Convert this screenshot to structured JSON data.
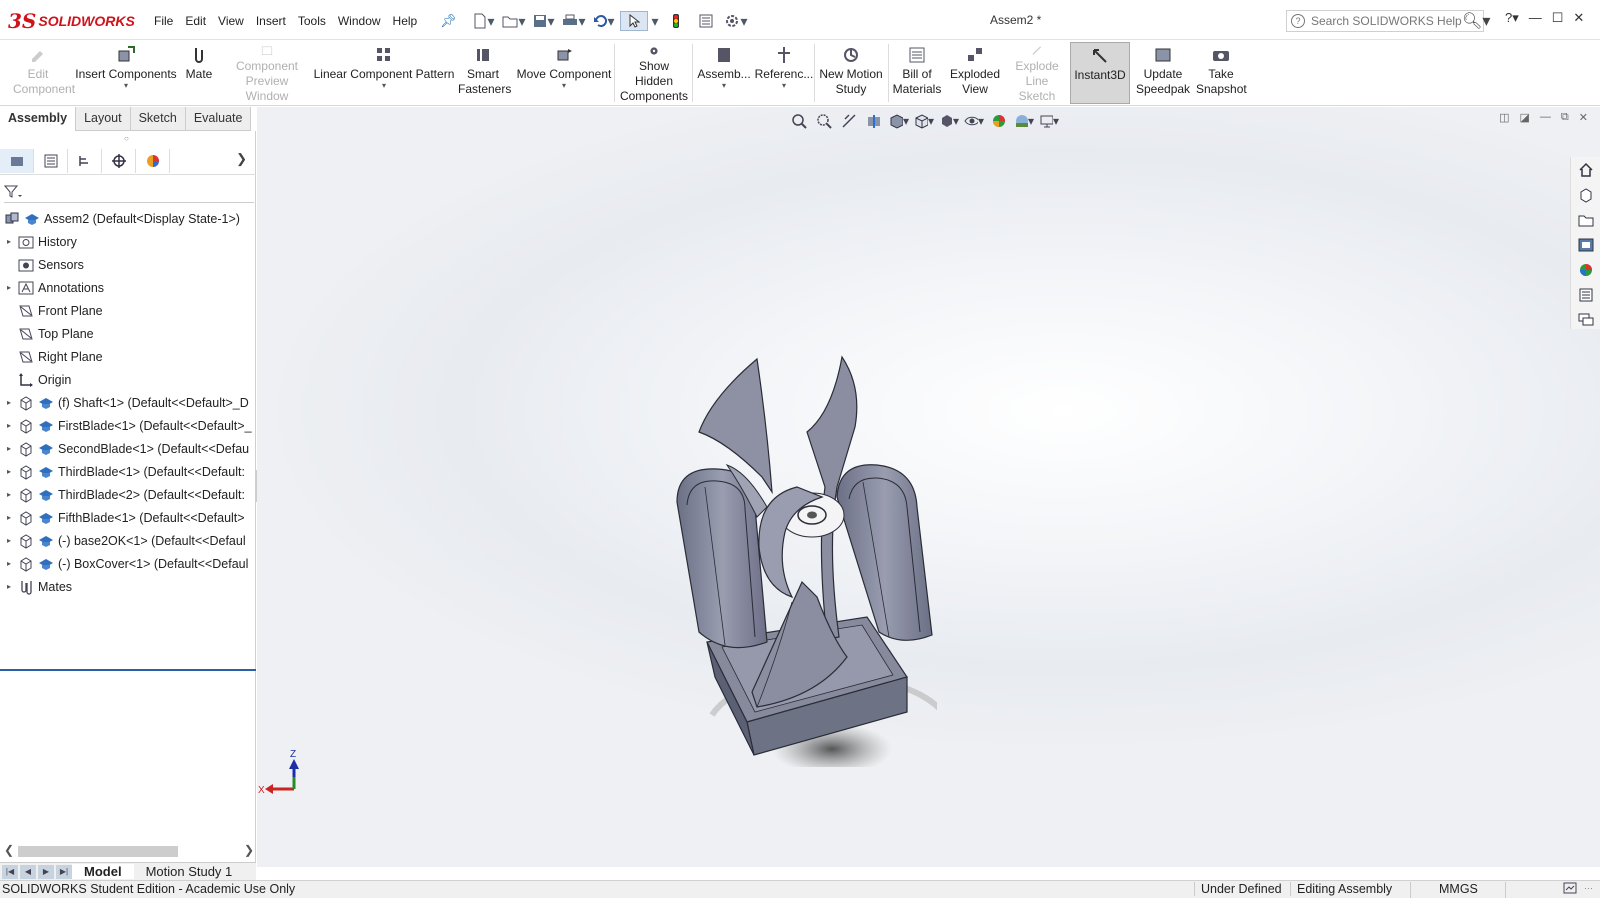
{
  "app": {
    "brand_prefix": "3S",
    "brand": "SOLIDWORKS",
    "document_title": "Assem2 *"
  },
  "menus": [
    "File",
    "Edit",
    "View",
    "Insert",
    "Tools",
    "Window",
    "Help"
  ],
  "search": {
    "placeholder": "Search SOLIDWORKS Help"
  },
  "commands": {
    "edit_component": "Edit Component",
    "insert_components": "Insert Components",
    "mate": "Mate",
    "component_preview_window": "Component Preview Window",
    "linear_component_pattern": "Linear Component Pattern",
    "smart_fasteners": "Smart Fasteners",
    "move_component": "Move Component",
    "show_hidden_components": "Show Hidden Components",
    "assembly": "Assemb...",
    "reference": "Referenc...",
    "new_motion_study": "New Motion Study",
    "bill_of_materials": "Bill of Materials",
    "exploded_view": "Exploded View",
    "explode_line_sketch": "Explode Line Sketch",
    "instant3d": "Instant3D",
    "update_speedpak": "Update Speedpak",
    "take_snapshot": "Take Snapshot"
  },
  "cm_tabs": [
    "Assembly",
    "Layout",
    "Sketch",
    "Evaluate"
  ],
  "tree": {
    "root": "Assem2  (Default<Display State-1>)",
    "items": [
      "History",
      "Sensors",
      "Annotations",
      "Front Plane",
      "Top Plane",
      "Right Plane",
      "Origin",
      "(f) Shaft<1> (Default<<Default>_D",
      "FirstBlade<1> (Default<<Default>_",
      "SecondBlade<1> (Default<<Defau",
      "ThirdBlade<1> (Default<<Default:",
      "ThirdBlade<2> (Default<<Default:",
      "FifthBlade<1> (Default<<Default>",
      "(-) base2OK<1> (Default<<Defaul",
      "(-) BoxCover<1> (Default<<Defaul",
      "Mates"
    ]
  },
  "triad": {
    "z": "Z",
    "x": "X"
  },
  "bottom_tabs": [
    "Model",
    "Motion Study 1"
  ],
  "status": {
    "edition": "SOLIDWORKS Student Edition - Academic Use Only",
    "defined": "Under Defined",
    "mode": "Editing Assembly",
    "units": "MMGS",
    "units_caret": "˄"
  },
  "colors": {
    "brand_red": "#d0121b",
    "model_face": "#7f8396",
    "model_edge": "#2a2c36"
  }
}
